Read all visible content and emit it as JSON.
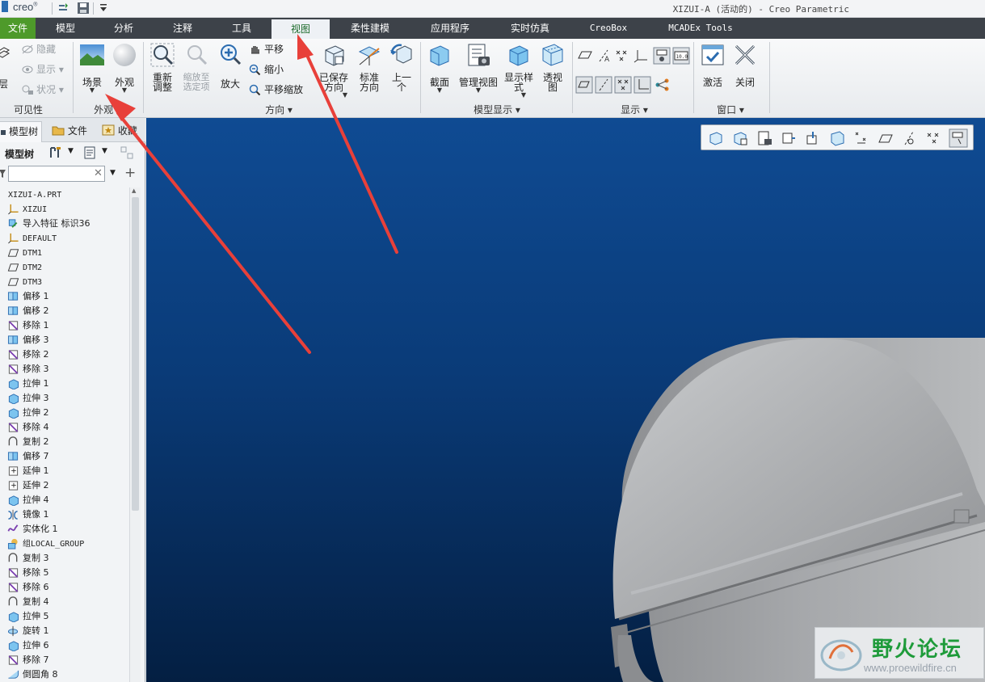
{
  "app": {
    "logo": "creo",
    "window_title": "XIZUI-A (活动的) - Creo Parametric"
  },
  "menu_tabs": [
    "文件",
    "模型",
    "分析",
    "注释",
    "工具",
    "视图",
    "柔性建模",
    "应用程序",
    "实时仿真",
    "CreoBox",
    "MCADEx Tools"
  ],
  "active_tab": "视图",
  "ribbon": {
    "visibility": {
      "hide": "隐藏",
      "display": "显示",
      "status": "状况",
      "layer": "层",
      "label": "可见性"
    },
    "appearance": {
      "scene": "场景",
      "appearance": "外观",
      "label": "外观"
    },
    "orientation": {
      "refit": "重新调整",
      "zoom_to_selected": "缩放至选定项",
      "zoom_in": "放大",
      "pan": "平移",
      "zoom_out": "缩小",
      "pan_zoom": "平移缩放",
      "saved_orientations": "已保存方向",
      "standard_orientation": "标准方向",
      "previous": "上一个",
      "label": "方向"
    },
    "model_display": {
      "section": "截面",
      "manage_views": "管理视图",
      "display_style": "显示样式",
      "perspective": "透视图",
      "label": "模型显示"
    },
    "show": {
      "label": "显示"
    },
    "window": {
      "activate": "激活",
      "close": "关闭",
      "label": "窗口"
    }
  },
  "left_panel": {
    "tabs": [
      "模型树",
      "文件",
      "收藏"
    ],
    "tree_title": "模型树",
    "search_placeholder": "",
    "tree_items": [
      {
        "label": "XIZUI-A.PRT",
        "icon": "part-icon"
      },
      {
        "label": "XIZUI",
        "icon": "csys-icon"
      },
      {
        "label": "导入特征 标识36",
        "icon": "import-feature-icon"
      },
      {
        "label": "DEFAULT",
        "icon": "csys-icon"
      },
      {
        "label": "DTM1",
        "icon": "datum-plane-icon"
      },
      {
        "label": "DTM2",
        "icon": "datum-plane-icon"
      },
      {
        "label": "DTM3",
        "icon": "datum-plane-icon"
      },
      {
        "label": "偏移 1",
        "icon": "offset-icon"
      },
      {
        "label": "偏移 2",
        "icon": "offset-icon"
      },
      {
        "label": "移除 1",
        "icon": "remove-icon"
      },
      {
        "label": "偏移 3",
        "icon": "offset-icon"
      },
      {
        "label": "移除 2",
        "icon": "remove-icon"
      },
      {
        "label": "移除 3",
        "icon": "remove-icon"
      },
      {
        "label": "拉伸 1",
        "icon": "extrude-icon"
      },
      {
        "label": "拉伸 3",
        "icon": "extrude-icon"
      },
      {
        "label": "拉伸 2",
        "icon": "extrude-icon"
      },
      {
        "label": "移除 4",
        "icon": "remove-icon"
      },
      {
        "label": "复制 2",
        "icon": "copy-icon"
      },
      {
        "label": "偏移 7",
        "icon": "offset-icon"
      },
      {
        "label": "延伸 1",
        "icon": "extend-icon"
      },
      {
        "label": "延伸 2",
        "icon": "extend-icon"
      },
      {
        "label": "拉伸 4",
        "icon": "extrude-icon"
      },
      {
        "label": "镜像 1",
        "icon": "mirror-icon"
      },
      {
        "label": "实体化 1",
        "icon": "solidify-icon"
      },
      {
        "label": "组LOCAL_GROUP",
        "icon": "group-icon"
      },
      {
        "label": "复制 3",
        "icon": "copy-icon"
      },
      {
        "label": "移除 5",
        "icon": "remove-icon"
      },
      {
        "label": "移除 6",
        "icon": "remove-icon"
      },
      {
        "label": "复制 4",
        "icon": "copy-icon"
      },
      {
        "label": "拉伸 5",
        "icon": "extrude-icon"
      },
      {
        "label": "旋转 1",
        "icon": "revolve-icon"
      },
      {
        "label": "拉伸 6",
        "icon": "extrude-icon"
      },
      {
        "label": "移除 7",
        "icon": "remove-icon"
      },
      {
        "label": "倒圆角 8",
        "icon": "round-icon"
      }
    ]
  },
  "watermark": {
    "title": "野火论坛",
    "url": "www.proewildfire.cn"
  },
  "colors": {
    "file_tab": "#4e9a2a",
    "tabbar": "#3d4249",
    "viewport_top": "#0f4b93",
    "viewport_bottom": "#041f42",
    "annotation_arrow": "#e8403a",
    "active_tab_text": "#1b6a2a"
  }
}
